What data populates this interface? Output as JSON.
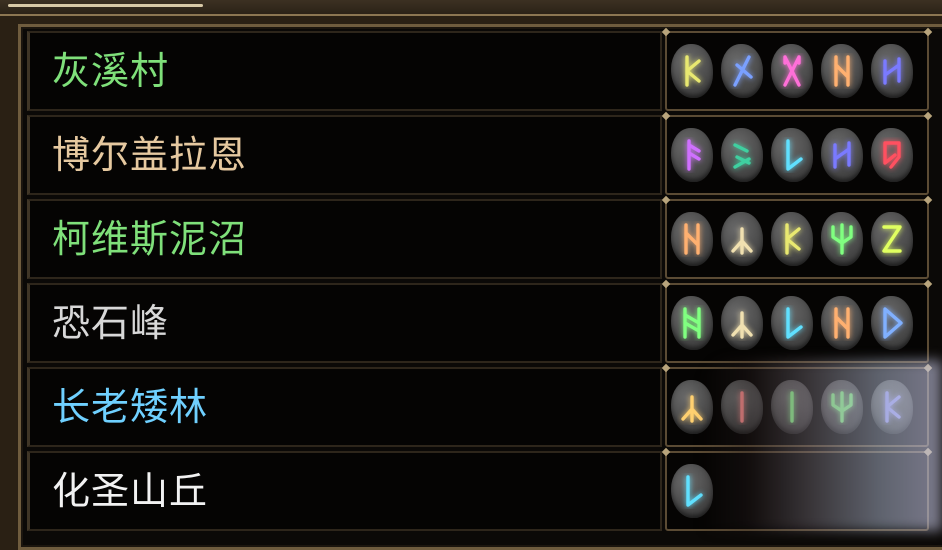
{
  "locations": [
    {
      "name": "灰溪村",
      "color": "#7fe07a",
      "runes": [
        {
          "glyph": "rune-kaun",
          "color": "#e8e870"
        },
        {
          "glyph": "rune-slash",
          "color": "#7aa0ff"
        },
        {
          "glyph": "rune-x",
          "color": "#ff6fd8"
        },
        {
          "glyph": "rune-n",
          "color": "#ffb070"
        },
        {
          "glyph": "rune-h",
          "color": "#7a7aff"
        }
      ]
    },
    {
      "name": "博尔盖拉恩",
      "color": "#e6c9a0",
      "runes": [
        {
          "glyph": "rune-a",
          "color": "#d070ff"
        },
        {
          "glyph": "rune-s",
          "color": "#3fd0a0"
        },
        {
          "glyph": "rune-l",
          "color": "#60e0ff"
        },
        {
          "glyph": "rune-h",
          "color": "#7a7aff"
        },
        {
          "glyph": "rune-e",
          "color": "#ff5060"
        }
      ]
    },
    {
      "name": "柯维斯泥沼",
      "color": "#7fe07a",
      "runes": [
        {
          "glyph": "rune-n",
          "color": "#ffb070"
        },
        {
          "glyph": "rune-y",
          "color": "#f0e0b0"
        },
        {
          "glyph": "rune-kaun",
          "color": "#e8e870"
        },
        {
          "glyph": "rune-psi",
          "color": "#80ff80"
        },
        {
          "glyph": "rune-z",
          "color": "#e0ff60"
        }
      ]
    },
    {
      "name": "恐石峰",
      "color": "#d8d8d8",
      "runes": [
        {
          "glyph": "rune-nn",
          "color": "#80ff80"
        },
        {
          "glyph": "rune-y",
          "color": "#f0e0b0"
        },
        {
          "glyph": "rune-l",
          "color": "#60e0ff"
        },
        {
          "glyph": "rune-n",
          "color": "#ffb070"
        },
        {
          "glyph": "rune-d",
          "color": "#80b0ff"
        }
      ]
    },
    {
      "name": "长老矮林",
      "color": "#6fd0ff",
      "runes": [
        {
          "glyph": "rune-y",
          "color": "#ffd070"
        },
        {
          "glyph": "rune-i",
          "color": "#ff9090"
        },
        {
          "glyph": "rune-i",
          "color": "#90ff90"
        },
        {
          "glyph": "rune-psi",
          "color": "#90ff90"
        },
        {
          "glyph": "rune-kaun",
          "color": "#a0a0ff"
        }
      ]
    },
    {
      "name": "化圣山丘",
      "color": "#f2f2f2",
      "runes": [
        {
          "glyph": "rune-l",
          "color": "#60e0ff"
        }
      ]
    }
  ]
}
